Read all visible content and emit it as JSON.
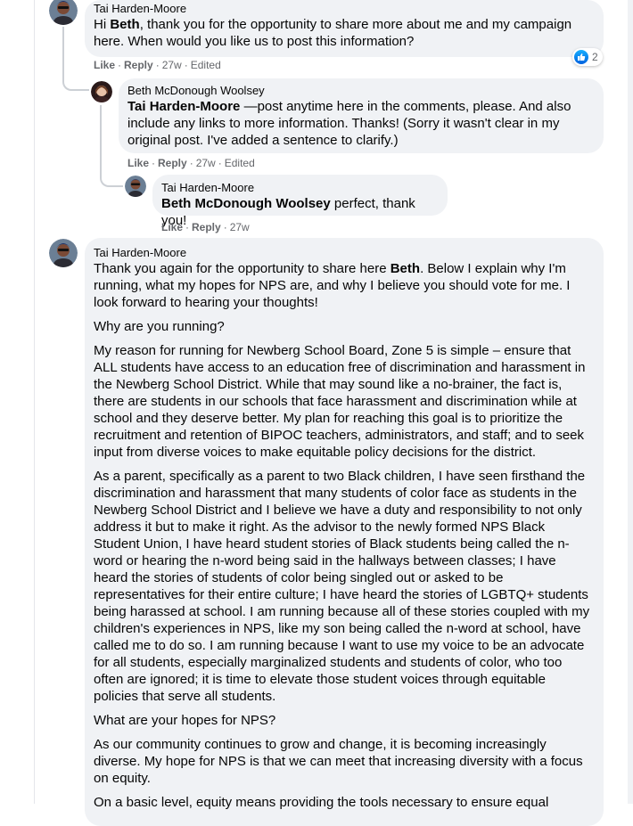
{
  "comments": {
    "c1": {
      "author": "Tai Harden-Moore",
      "text_pre": "Hi ",
      "mention": "Beth",
      "text_post": ", thank you for the opportunity to share more about me and my campaign here. When would you like us to post this information?",
      "like": "Like",
      "reply": "Reply",
      "time": "27w",
      "edited": "Edited",
      "reaction_count": "2"
    },
    "c2": {
      "author": "Beth McDonough Woolsey",
      "mention": "Tai Harden-Moore",
      "text_post": " —post anytime here in the comments, please. And also include any links to more information. Thanks! (Sorry it wasn't clear in my original post. I've added a sentence to clarify.)",
      "like": "Like",
      "reply": "Reply",
      "time": "27w",
      "edited": "Edited"
    },
    "c3": {
      "author": "Tai Harden-Moore",
      "mention": "Beth McDonough Woolsey",
      "text_post": " perfect, thank you!",
      "like": "Like",
      "reply": "Reply",
      "time": "27w"
    },
    "c4": {
      "author": "Tai Harden-Moore",
      "p1_pre": "Thank you again for the opportunity to share here ",
      "p1_mention": "Beth",
      "p1_post": ". Below I explain why I'm running, what my hopes for NPS are, and why I believe you should vote for me. I look forward to hearing your thoughts!",
      "p2": "Why are you running?",
      "p3": "My reason for running for Newberg School Board, Zone 5 is simple – ensure that ALL students have access to an education free of discrimination and harassment in the Newberg School District. While that may sound like a no-brainer, the fact is, there are students in our schools that face harassment and discrimination while at school and they deserve better. My plan for reaching this goal is to prioritize the recruitment and retention of BIPOC teachers, administrators, and staff; and to seek input from diverse voices to make equitable policy decisions for the district.",
      "p4": "As a parent, specifically as a parent to two Black children, I have seen firsthand the discrimination and harassment that many students of color face as students in the Newberg School District and I believe we have a duty and responsibility to not only address it but to make it right. As the advisor to the newly formed NPS Black Student Union, I have heard student stories of Black students being called the n-word or hearing the n-word being said in the hallways between classes; I have heard the stories of students of color being singled out or asked to be representatives for their entire culture; I have heard the stories of LGBTQ+ students being harassed at school. I am running because all of these stories coupled with my children's experiences in NPS, like my son being called the n-word at school, have called me to do so. I am running because I want to use my voice to be an advocate for all students, especially marginalized students and students of color, who too often are ignored; it is time to elevate those student voices through equitable policies that serve all students.",
      "p5": "What are your hopes for NPS?",
      "p6": "As our community continues to grow and change, it is becoming increasingly diverse. My hope for NPS is that we can meet that increasing diversity with a focus on equity.",
      "p7": "On a basic level, equity means providing the tools necessary to ensure equal"
    }
  },
  "colors": {
    "bubble": "#f0f2f5",
    "meta": "#65676b",
    "like_blue": "#1877f2"
  }
}
